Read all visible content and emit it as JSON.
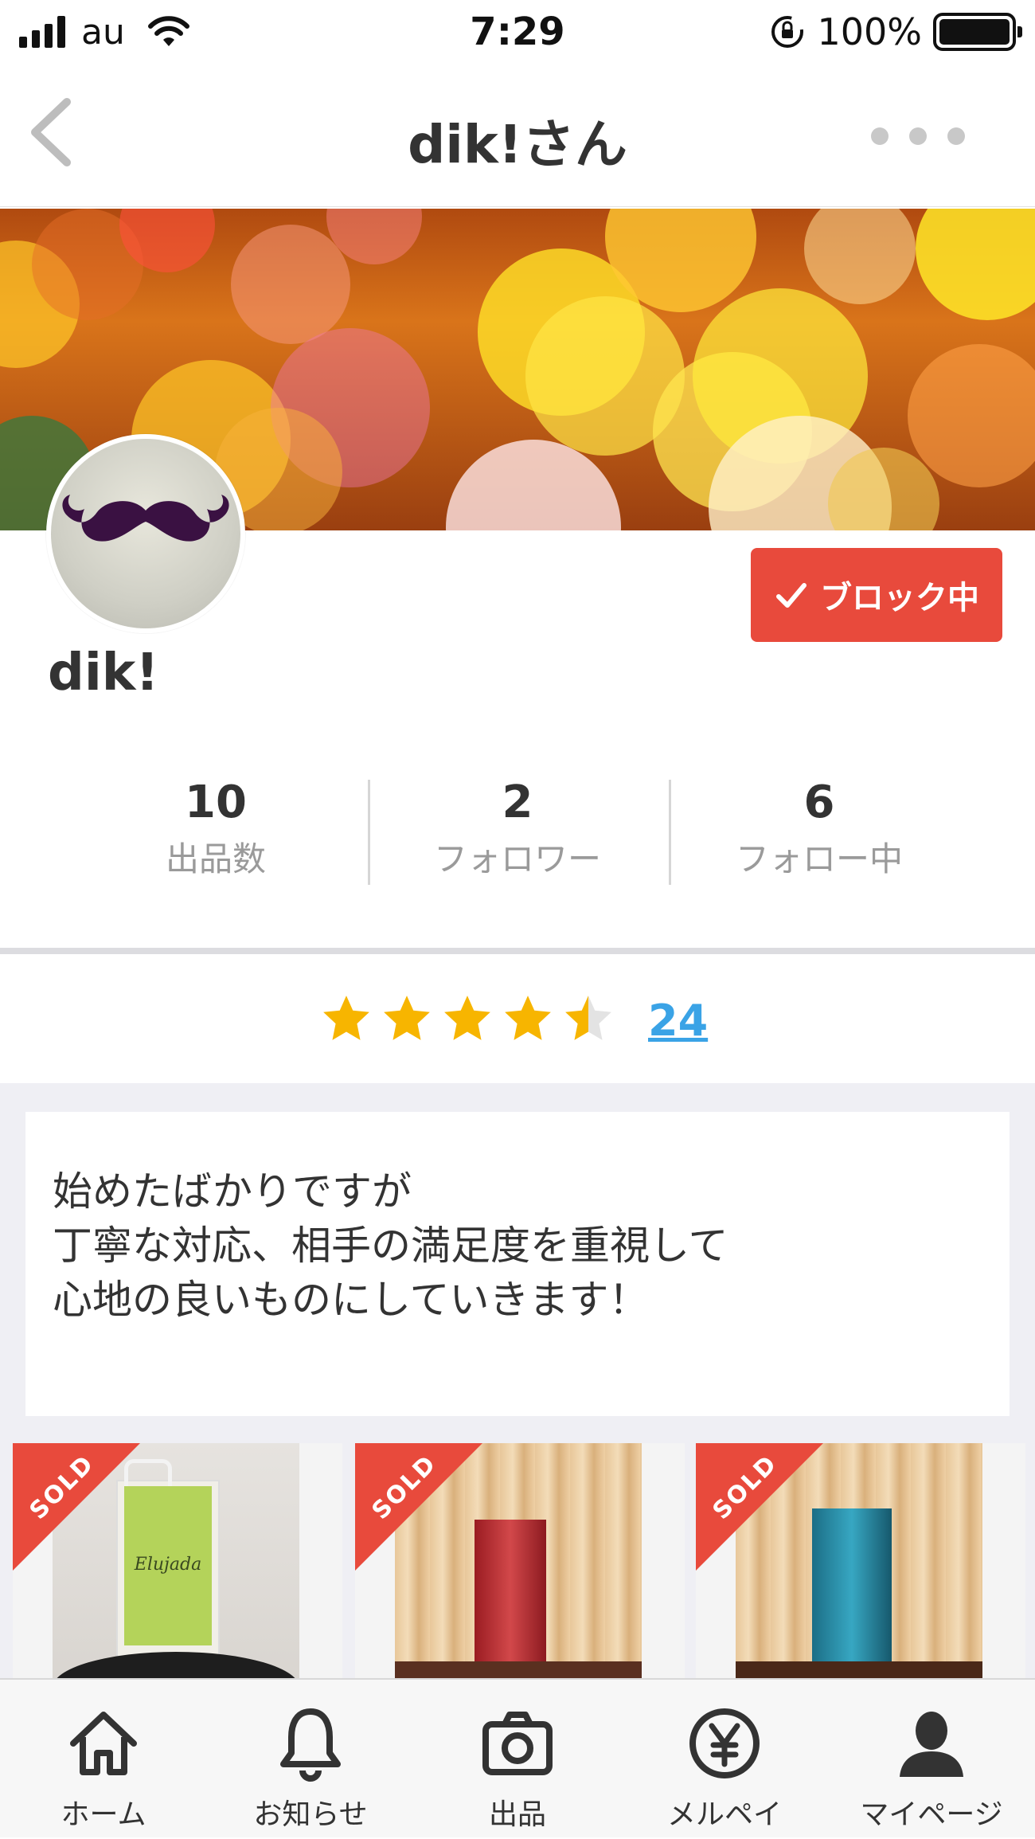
{
  "status_bar": {
    "carrier": "au",
    "time": "7:29",
    "battery": "100%",
    "battery_level": 1.0
  },
  "header": {
    "title": "dik!さん",
    "back_icon": "chevron-left-icon",
    "more_icon": "more-dots-icon"
  },
  "profile": {
    "avatar_icon": "mustache-icon",
    "name": "dik!",
    "block_button": {
      "label": "ブロック中",
      "icon": "check-icon",
      "color": "#e84a3c"
    }
  },
  "stats": [
    {
      "value": "10",
      "label": "出品数"
    },
    {
      "value": "2",
      "label": "フォロワー"
    },
    {
      "value": "6",
      "label": "フォロー中"
    }
  ],
  "rating": {
    "stars": 4.5,
    "max": 5,
    "count": "24",
    "star_color": "#f7b500"
  },
  "bio": {
    "lines": [
      "始めたばかりですが",
      "丁寧な対応、相手の満足度を重視して",
      "心地の良いものにしていきます！"
    ]
  },
  "items": [
    {
      "badge": "SOLD",
      "product_text": "Elujada"
    },
    {
      "badge": "SOLD"
    },
    {
      "badge": "SOLD"
    }
  ],
  "tabbar": [
    {
      "label": "ホーム",
      "icon": "home-icon"
    },
    {
      "label": "お知らせ",
      "icon": "bell-icon"
    },
    {
      "label": "出品",
      "icon": "camera-icon"
    },
    {
      "label": "メルペイ",
      "icon": "yen-icon"
    },
    {
      "label": "マイページ",
      "icon": "person-icon"
    }
  ],
  "colors": {
    "accent_red": "#e84a3c",
    "link_blue": "#3aa3e6",
    "background_gray": "#efeff4"
  }
}
